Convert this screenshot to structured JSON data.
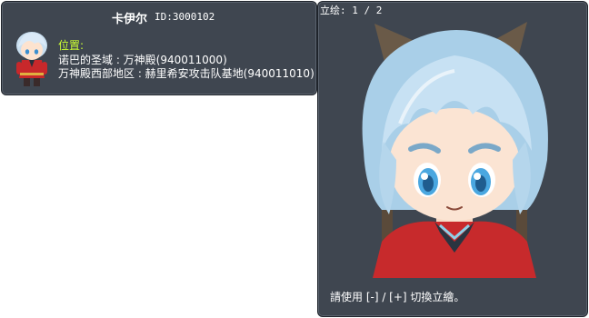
{
  "npc": {
    "name": "卡伊尔",
    "id_text": "ID:3000102"
  },
  "location": {
    "label": "位置:",
    "lines": [
      "诺巴的圣域 : 万神殿(940011000)",
      "万神殿西部地区 : 赫里希安攻击队基地(940011010)"
    ]
  },
  "portrait": {
    "counter": "立绘: 1 / 2",
    "hint": "請使用 [-] / [+] 切換立繪。"
  },
  "icons": {
    "mini_avatar": "npc-mini-avatar-icon",
    "portrait": "npc-portrait"
  },
  "colors": {
    "panel_bg": "#3f4650",
    "location_label": "#ccff33",
    "text": "#ffffff"
  }
}
